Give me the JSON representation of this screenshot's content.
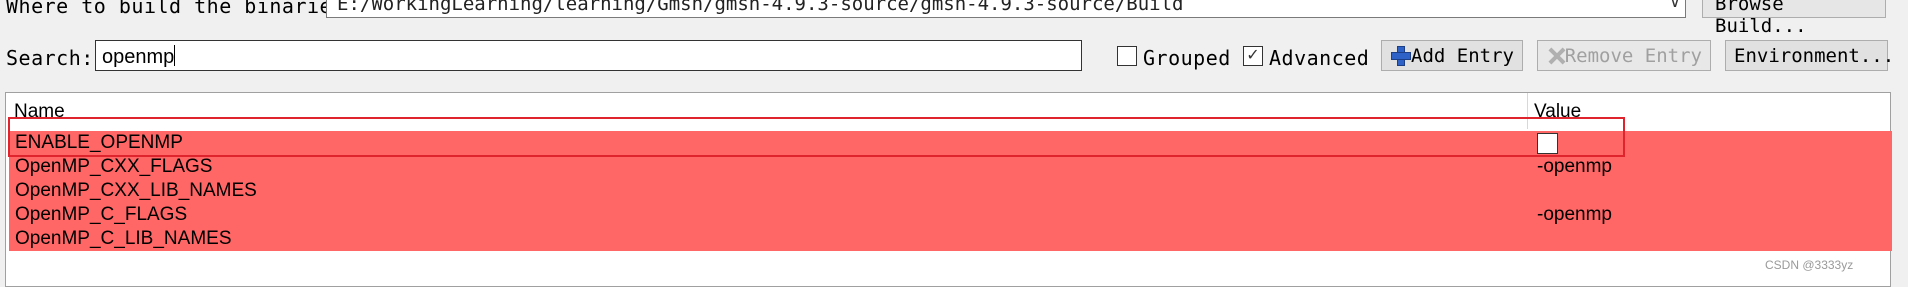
{
  "build": {
    "label": "Where to build the binaries:",
    "path": "E:/WorkingLearning/learning/Gmsh/gmsh-4.9.3-source/gmsh-4.9.3-source/Build",
    "browse_label": "Browse Build..."
  },
  "search": {
    "label": "Search:",
    "value": "openmp"
  },
  "options": {
    "grouped_label": "Grouped",
    "grouped_checked": false,
    "advanced_label": "Advanced",
    "advanced_checked": true,
    "checkmark": "✓"
  },
  "buttons": {
    "add_entry": "Add Entry",
    "remove_entry": "Remove Entry",
    "environment": "Environment..."
  },
  "table": {
    "columns": [
      "Name",
      "Value"
    ],
    "rows": [
      {
        "name": "ENABLE_OPENMP",
        "value": "",
        "type": "bool",
        "checked": false
      },
      {
        "name": "OpenMP_CXX_FLAGS",
        "value": "-openmp"
      },
      {
        "name": "OpenMP_CXX_LIB_NAMES",
        "value": ""
      },
      {
        "name": "OpenMP_C_FLAGS",
        "value": "-openmp"
      },
      {
        "name": "OpenMP_C_LIB_NAMES",
        "value": ""
      }
    ],
    "row_color": "#ff6666"
  },
  "annotation_color": "#e0242e",
  "watermark": "CSDN @3333yz"
}
